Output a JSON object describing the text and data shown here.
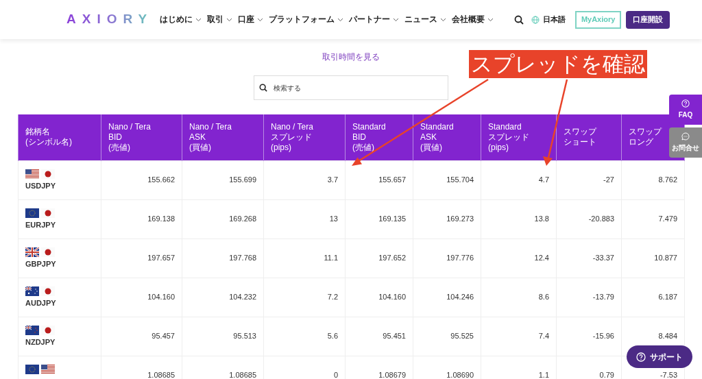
{
  "header": {
    "logo": "AXIORY",
    "nav": [
      {
        "label": "はじめに"
      },
      {
        "label": "取引"
      },
      {
        "label": "口座"
      },
      {
        "label": "プラットフォーム"
      },
      {
        "label": "パートナー"
      },
      {
        "label": "ニュース"
      },
      {
        "label": "会社概要"
      }
    ],
    "language": "日本語",
    "login_button": "MyAxiory",
    "signup_button": "口座開設"
  },
  "hours_link": "取引時間を見る",
  "search": {
    "placeholder": "検索する"
  },
  "table": {
    "columns": [
      [
        "銘柄名",
        "(シンボル名)"
      ],
      [
        "Nano / Tera",
        "BID",
        "(売値)"
      ],
      [
        "Nano / Tera",
        "ASK",
        "(買値)"
      ],
      [
        "Nano / Tera",
        "スプレッド",
        "(pips)"
      ],
      [
        "Standard",
        "BID",
        "(売値)"
      ],
      [
        "Standard",
        "ASK",
        "(買値)"
      ],
      [
        "Standard",
        "スプレッド",
        "(pips)"
      ],
      [
        "スワップ",
        "ショート"
      ],
      [
        "スワップ",
        "ロング"
      ]
    ],
    "rows": [
      {
        "flags": [
          {
            "kind": "us"
          },
          {
            "kind": "jp"
          }
        ],
        "symbol": "USDJPY",
        "values": [
          "155.662",
          "155.699",
          "3.7",
          "155.657",
          "155.704",
          "4.7",
          "-27",
          "8.762"
        ]
      },
      {
        "flags": [
          {
            "kind": "eu"
          },
          {
            "kind": "jp"
          }
        ],
        "symbol": "EURJPY",
        "values": [
          "169.138",
          "169.268",
          "13",
          "169.135",
          "169.273",
          "13.8",
          "-20.883",
          "7.479"
        ]
      },
      {
        "flags": [
          {
            "kind": "gb"
          },
          {
            "kind": "jp"
          }
        ],
        "symbol": "GBPJPY",
        "values": [
          "197.657",
          "197.768",
          "11.1",
          "197.652",
          "197.776",
          "12.4",
          "-33.37",
          "10.877"
        ]
      },
      {
        "flags": [
          {
            "kind": "au"
          },
          {
            "kind": "jp"
          }
        ],
        "symbol": "AUDJPY",
        "values": [
          "104.160",
          "104.232",
          "7.2",
          "104.160",
          "104.246",
          "8.6",
          "-13.79",
          "6.187"
        ]
      },
      {
        "flags": [
          {
            "kind": "nz"
          },
          {
            "kind": "jp"
          }
        ],
        "symbol": "NZDJPY",
        "values": [
          "95.457",
          "95.513",
          "5.6",
          "95.451",
          "95.525",
          "7.4",
          "-15.96",
          "8.484"
        ]
      },
      {
        "flags": [
          {
            "kind": "eu"
          },
          {
            "kind": "us"
          }
        ],
        "values": [
          "1.08685",
          "1.08685",
          "0",
          "1.08679",
          "1.08690",
          "1.1",
          "0.79",
          "-7.53"
        ]
      }
    ]
  },
  "side_tabs": [
    {
      "kind": "faq",
      "label": "FAQ"
    },
    {
      "kind": "contact",
      "label": "お問合せ"
    }
  ],
  "support_button": "サポート",
  "annotation": "スプレッドを確認"
}
